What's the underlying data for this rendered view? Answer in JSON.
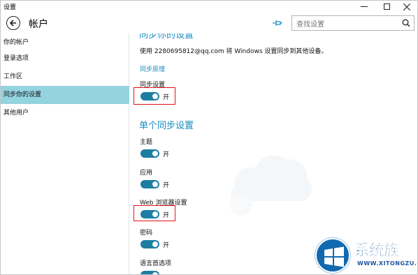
{
  "window": {
    "title": "设置"
  },
  "header": {
    "page_title": "帐户",
    "search_placeholder": "查找设置"
  },
  "sidebar": {
    "items": [
      {
        "label": "你的帐户"
      },
      {
        "label": "登录选项"
      },
      {
        "label": "工作区"
      },
      {
        "label": "同步你的设置",
        "selected": true
      },
      {
        "label": "其他用户"
      }
    ]
  },
  "content": {
    "cut_heading": "同步你的设置",
    "description": "使用 2280695812@qq.com 将 Windows 设置同步到其他设备。",
    "sync_link": "同步原理",
    "sync_settings": {
      "label": "同步设置",
      "state_text": "开",
      "on": true
    },
    "section_heading": "单个同步设置",
    "individual": [
      {
        "label": "主题",
        "state_text": "开",
        "on": true
      },
      {
        "label": "应用",
        "state_text": "开",
        "on": true
      },
      {
        "label": "Web 浏览器设置",
        "state_text": "开",
        "on": true
      },
      {
        "label": "密码",
        "state_text": "开",
        "on": true
      },
      {
        "label": "语言首选项",
        "state_text": "",
        "on": true
      }
    ]
  },
  "colors": {
    "accent": "#1a8cc0",
    "toggle_on": "#1c7ea1",
    "selected_nav": "#94d3e0",
    "highlight": "#e0131a"
  },
  "watermark": {
    "title": "系统族",
    "url": "WWW.XITONGZU.COM"
  }
}
